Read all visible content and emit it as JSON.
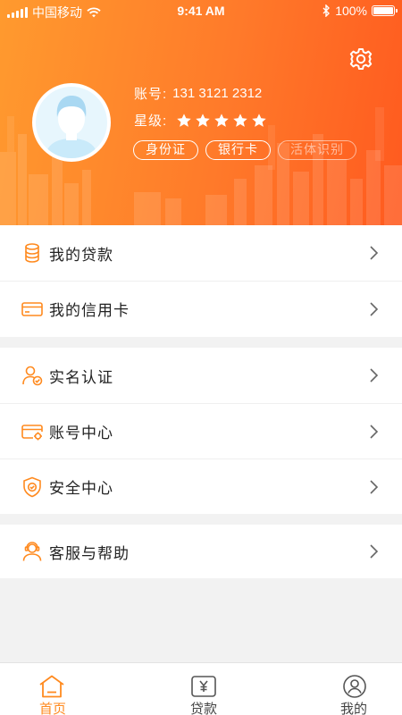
{
  "status_bar": {
    "carrier": "中国移动",
    "time": "9:41 AM",
    "battery": "100%"
  },
  "profile": {
    "account_label": "账号:",
    "account_value": "131 3121 2312",
    "level_label": "星级:",
    "star_rating": 5,
    "badges": [
      "身份证",
      "银行卡",
      "活体识别"
    ]
  },
  "menu": {
    "group1": [
      {
        "label": "我的贷款",
        "icon": "coins-icon"
      },
      {
        "label": "我的信用卡",
        "icon": "credit-card-icon"
      }
    ],
    "group2": [
      {
        "label": "实名认证",
        "icon": "user-verified-icon"
      },
      {
        "label": "账号中心",
        "icon": "account-card-icon"
      },
      {
        "label": "安全中心",
        "icon": "shield-icon"
      }
    ],
    "group3": [
      {
        "label": "客服与帮助",
        "icon": "headset-user-icon"
      }
    ]
  },
  "tabbar": [
    {
      "label": "首页",
      "active": true
    },
    {
      "label": "贷款",
      "active": false
    },
    {
      "label": "我的",
      "active": false
    }
  ],
  "colors": {
    "accent": "#ff8a1f",
    "header_start": "#ff9a2e",
    "header_end": "#ff5a1f",
    "background": "#f2f2f2"
  }
}
